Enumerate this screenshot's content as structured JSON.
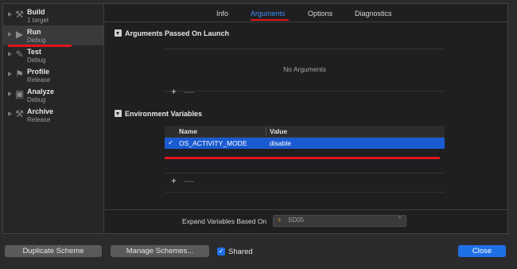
{
  "sidebar": {
    "items": [
      {
        "title": "Build",
        "subtitle": "1 target",
        "icon": "hammer-icon",
        "glyph": "⚒"
      },
      {
        "title": "Run",
        "subtitle": "Debug",
        "icon": "play-icon",
        "glyph": "▶"
      },
      {
        "title": "Test",
        "subtitle": "Debug",
        "icon": "wrench-icon",
        "glyph": "✎"
      },
      {
        "title": "Profile",
        "subtitle": "Release",
        "icon": "gauge-icon",
        "glyph": "⚑"
      },
      {
        "title": "Analyze",
        "subtitle": "Debug",
        "icon": "analyze-icon",
        "glyph": "▣"
      },
      {
        "title": "Archive",
        "subtitle": "Release",
        "icon": "archive-icon",
        "glyph": "⚒"
      }
    ],
    "selected": "Run"
  },
  "tabs": [
    {
      "label": "Info"
    },
    {
      "label": "Arguments"
    },
    {
      "label": "Options"
    },
    {
      "label": "Diagnostics"
    }
  ],
  "active_tab": "Arguments",
  "arguments_section": {
    "title": "Arguments Passed On Launch",
    "empty_text": "No Arguments",
    "add_label": "+",
    "remove_label": "—"
  },
  "env_section": {
    "title": "Environment Variables",
    "columns": [
      "Name",
      "Value"
    ],
    "rows": [
      {
        "checked": true,
        "check_glyph": "✓",
        "name": "OS_ACTIVITY_MODE",
        "value": "disable"
      }
    ],
    "add_label": "+",
    "remove_label": "—"
  },
  "expand": {
    "label": "Expand Variables Based On",
    "value": "SD05",
    "icon": "app-target-icon",
    "icon_glyph": "✈",
    "chevron_glyph": "⌃"
  },
  "footer": {
    "duplicate_label": "Duplicate Scheme",
    "manage_label": "Manage Schemes...",
    "shared_label": "Shared",
    "shared_checked": true,
    "shared_glyph": "✓",
    "close_label": "Close"
  },
  "colors": {
    "accent": "#1f6fe6",
    "tab_active": "#3d8ff5",
    "selection": "#1a5bd1",
    "annotation_red": "#e0161c"
  }
}
